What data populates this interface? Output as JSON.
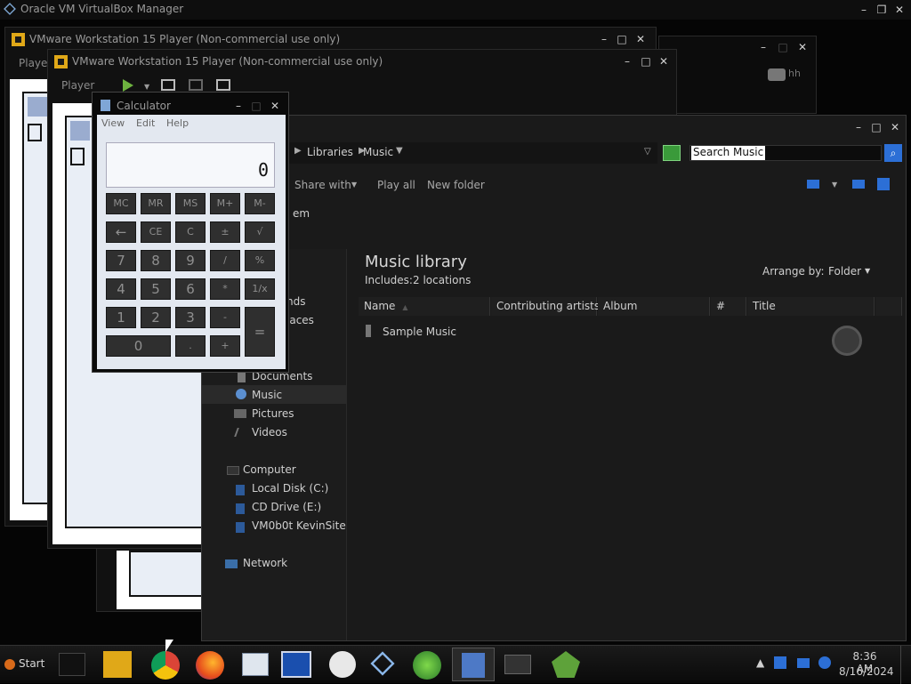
{
  "vbox": {
    "title": "Oracle VM VirtualBox Manager",
    "user_label": "hh"
  },
  "vmware_back": {
    "title": "VMware Workstation 15 Player (Non-commercial use only)",
    "menu": "Player"
  },
  "vmware_front": {
    "title": "VMware Workstation 15 Player (Non-commercial use only)",
    "menu": "Player"
  },
  "calculator": {
    "title": "Calculator",
    "menu": [
      "View",
      "Edit",
      "Help"
    ],
    "display": "0",
    "rows": [
      [
        "MC",
        "MR",
        "MS",
        "M+",
        "M-"
      ],
      [
        "←",
        "CE",
        "C",
        "±",
        "√"
      ],
      [
        "7",
        "8",
        "9",
        "/",
        "%"
      ],
      [
        "4",
        "5",
        "6",
        "*",
        "1/x"
      ],
      [
        "1",
        "2",
        "3",
        "-",
        "="
      ],
      [
        "0",
        ".",
        "+"
      ]
    ]
  },
  "explorer": {
    "breadcrumb": [
      "Libraries",
      "Music"
    ],
    "search_placeholder": "Search Music",
    "toolbar": {
      "share": "Share with",
      "play_all": "Play all",
      "new_folder": "New folder"
    },
    "partial_item": "em",
    "library_title": "Music library",
    "includes_label": "Includes:",
    "includes_link": "2 locations",
    "arrange_label": "Arrange by:",
    "arrange_value": "Folder",
    "columns": [
      "Name",
      "Contributing artists",
      "Album",
      "#",
      "Title"
    ],
    "files": [
      {
        "name": "Sample Music"
      }
    ],
    "nav": {
      "partial_downloads": "nds",
      "partial_places": "laces",
      "documents": "Documents",
      "music": "Music",
      "pictures": "Pictures",
      "videos": "Videos",
      "computer": "Computer",
      "local_disk": "Local Disk (C:)",
      "cd_drive": "CD Drive (E:)",
      "network_share": "VM0b0t KevinSite",
      "network": "Network"
    }
  },
  "taskbar": {
    "start_label": "Start",
    "time": "8:36 AM",
    "date": "8/16/2024",
    "apps": [
      "terminal",
      "vmware",
      "chrome",
      "firefox",
      "mail",
      "remote-desktop",
      "paint",
      "virtualbox",
      "windows",
      "calculator",
      "device-manager",
      "gem"
    ]
  },
  "colors": {
    "accent": "#2c6fd6",
    "background": "#000000",
    "window": "#1a1a1a"
  }
}
